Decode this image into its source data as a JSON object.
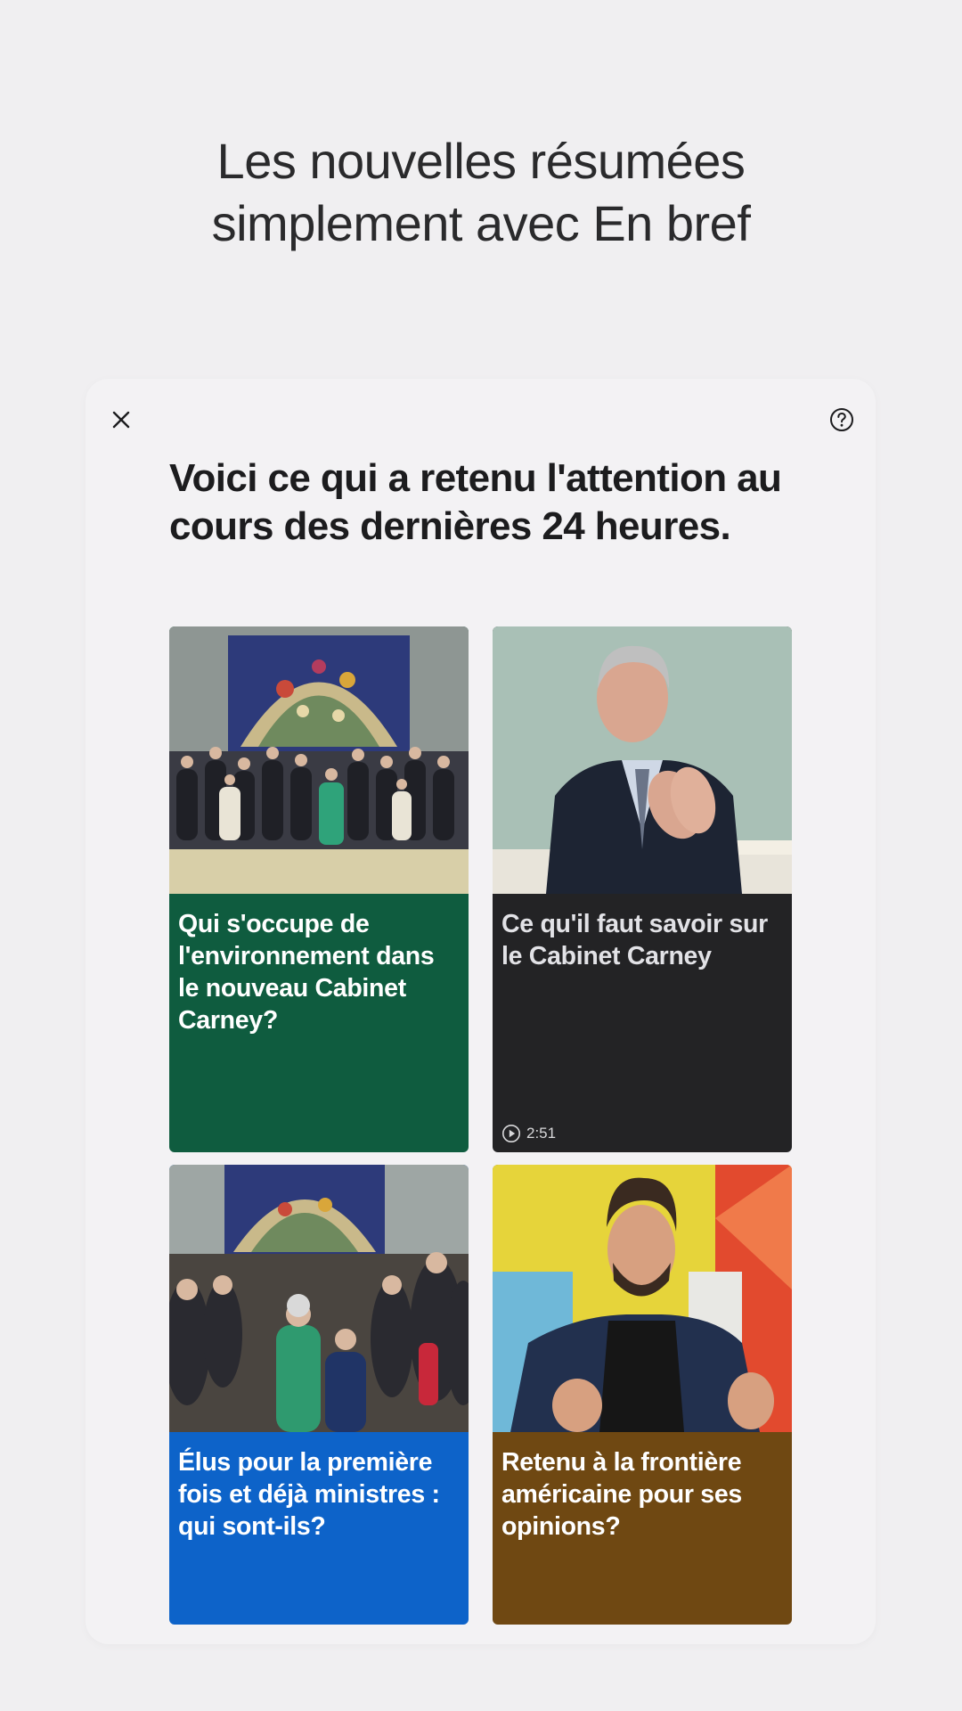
{
  "promo": {
    "heading_line1": "Les nouvelles résumées",
    "heading_line2": "simplement avec En bref"
  },
  "card": {
    "close_icon": "close-icon",
    "help_icon": "help-circle-icon",
    "title": "Voici ce qui a retenu l'attention au cours des dernières 24 heures."
  },
  "tiles": [
    {
      "caption": "Qui s'occupe de l'environnement dans le nouveau Cabinet Carney?",
      "color": "#0f5c3f",
      "image": "cabinet-group-photo"
    },
    {
      "caption": "Ce qu'il faut savoir sur le Cabinet Carney",
      "color": "#232325",
      "image": "man-clapping-portrait",
      "duration": "2:51",
      "duration_icon": "play-circle-icon"
    },
    {
      "caption": "Élus pour la première fois et déjà ministres : qui sont-ils?",
      "color": "#0d63c9",
      "image": "ceremony-crowd-photo"
    },
    {
      "caption": "Retenu à la frontière américaine pour ses opinions?",
      "color": "#6f4812",
      "image": "man-thumbs-up-portrait"
    }
  ]
}
